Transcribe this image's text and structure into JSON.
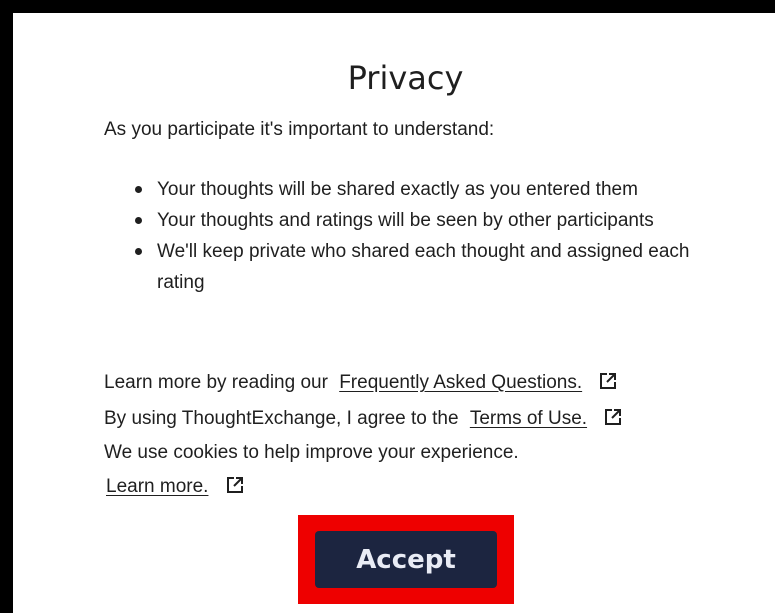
{
  "dialog": {
    "title": "Privacy",
    "intro": "As you participate it's important to understand:",
    "bullets": [
      "Your thoughts will be shared exactly as you entered them",
      "Your thoughts and ratings will be seen by other participants",
      "We'll keep private who shared each thought and assigned each rating"
    ],
    "faq_prefix": "Learn more by reading our",
    "faq_link": "Frequently Asked Questions.",
    "terms_prefix": "By using ThoughtExchange, I agree to the",
    "terms_link": "Terms of Use.",
    "cookies_text": "We use cookies to help improve your experience.",
    "cookies_link": "Learn more.",
    "accept_label": "Accept"
  },
  "icons": {
    "external_link": "external-link-icon"
  },
  "colors": {
    "background": "#000000",
    "dialog": "#ffffff",
    "text": "#1f1f1f",
    "button": "#1c2540",
    "button_text": "#e9ecf5",
    "highlight": "#ee0000"
  }
}
